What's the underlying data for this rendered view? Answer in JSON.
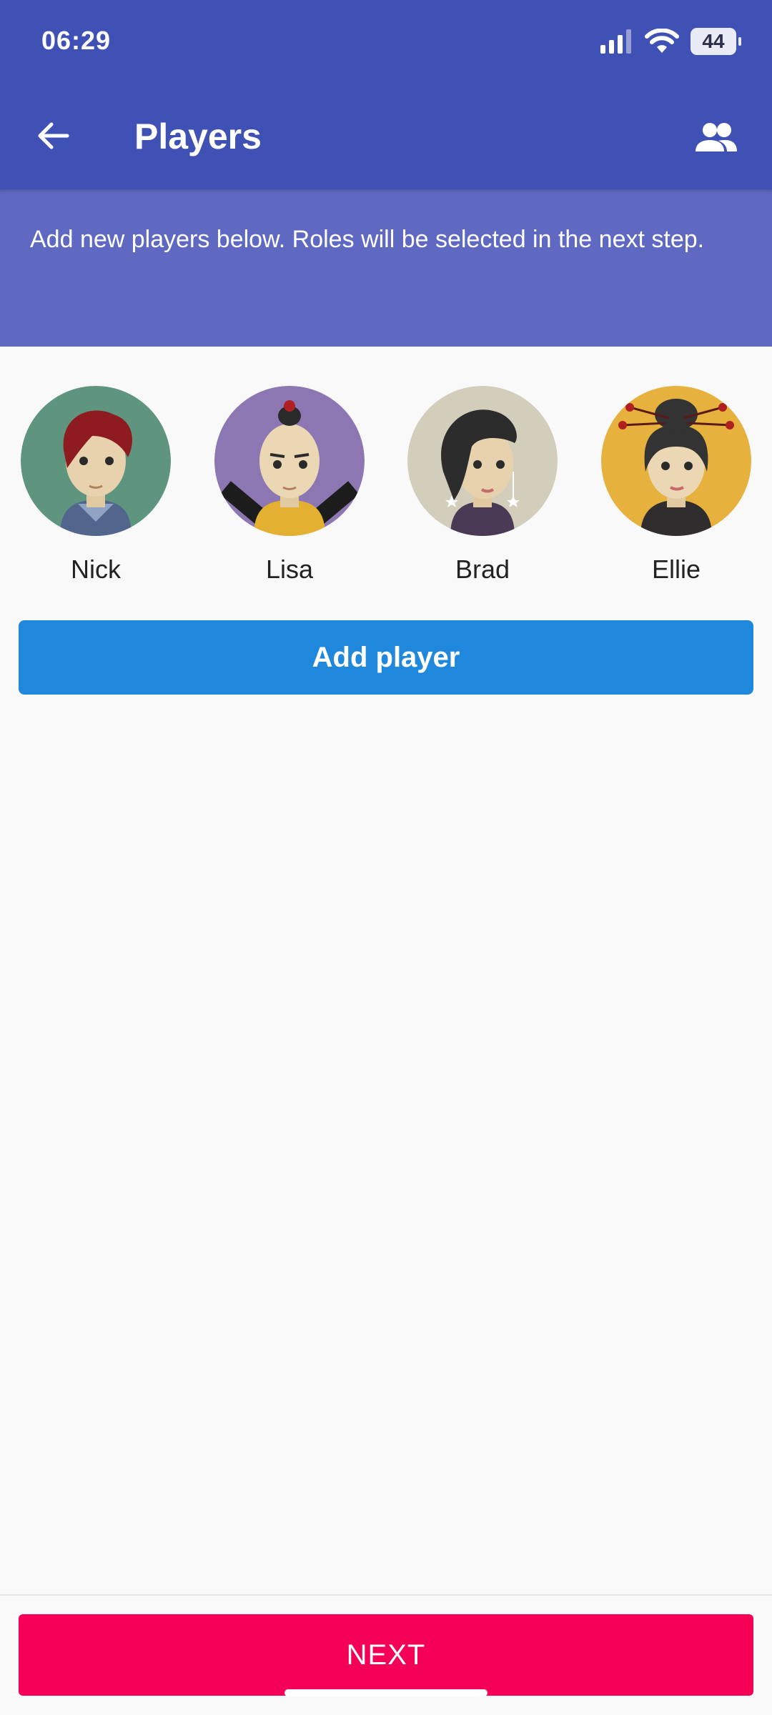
{
  "status_bar": {
    "time": "06:29",
    "battery": "44",
    "icons": [
      "signal-icon",
      "wifi-icon",
      "battery-icon"
    ]
  },
  "app_bar": {
    "title": "Players",
    "back_icon": "arrow-left-icon",
    "action_icon": "people-icon",
    "color": "#3f51b5"
  },
  "info": {
    "text": "Add new players below. Roles will be selected in the next step."
  },
  "players": [
    {
      "name": "Nick",
      "avatar_bg": "#5f957f"
    },
    {
      "name": "Lisa",
      "avatar_bg": "#8d77b3"
    },
    {
      "name": "Brad",
      "avatar_bg": "#d2cebb"
    },
    {
      "name": "Ellie",
      "avatar_bg": "#e7b13d"
    }
  ],
  "add_player_label": "Add player",
  "next_label": "NEXT",
  "colors": {
    "add_button": "#2088dc",
    "next_button": "#f50057"
  }
}
